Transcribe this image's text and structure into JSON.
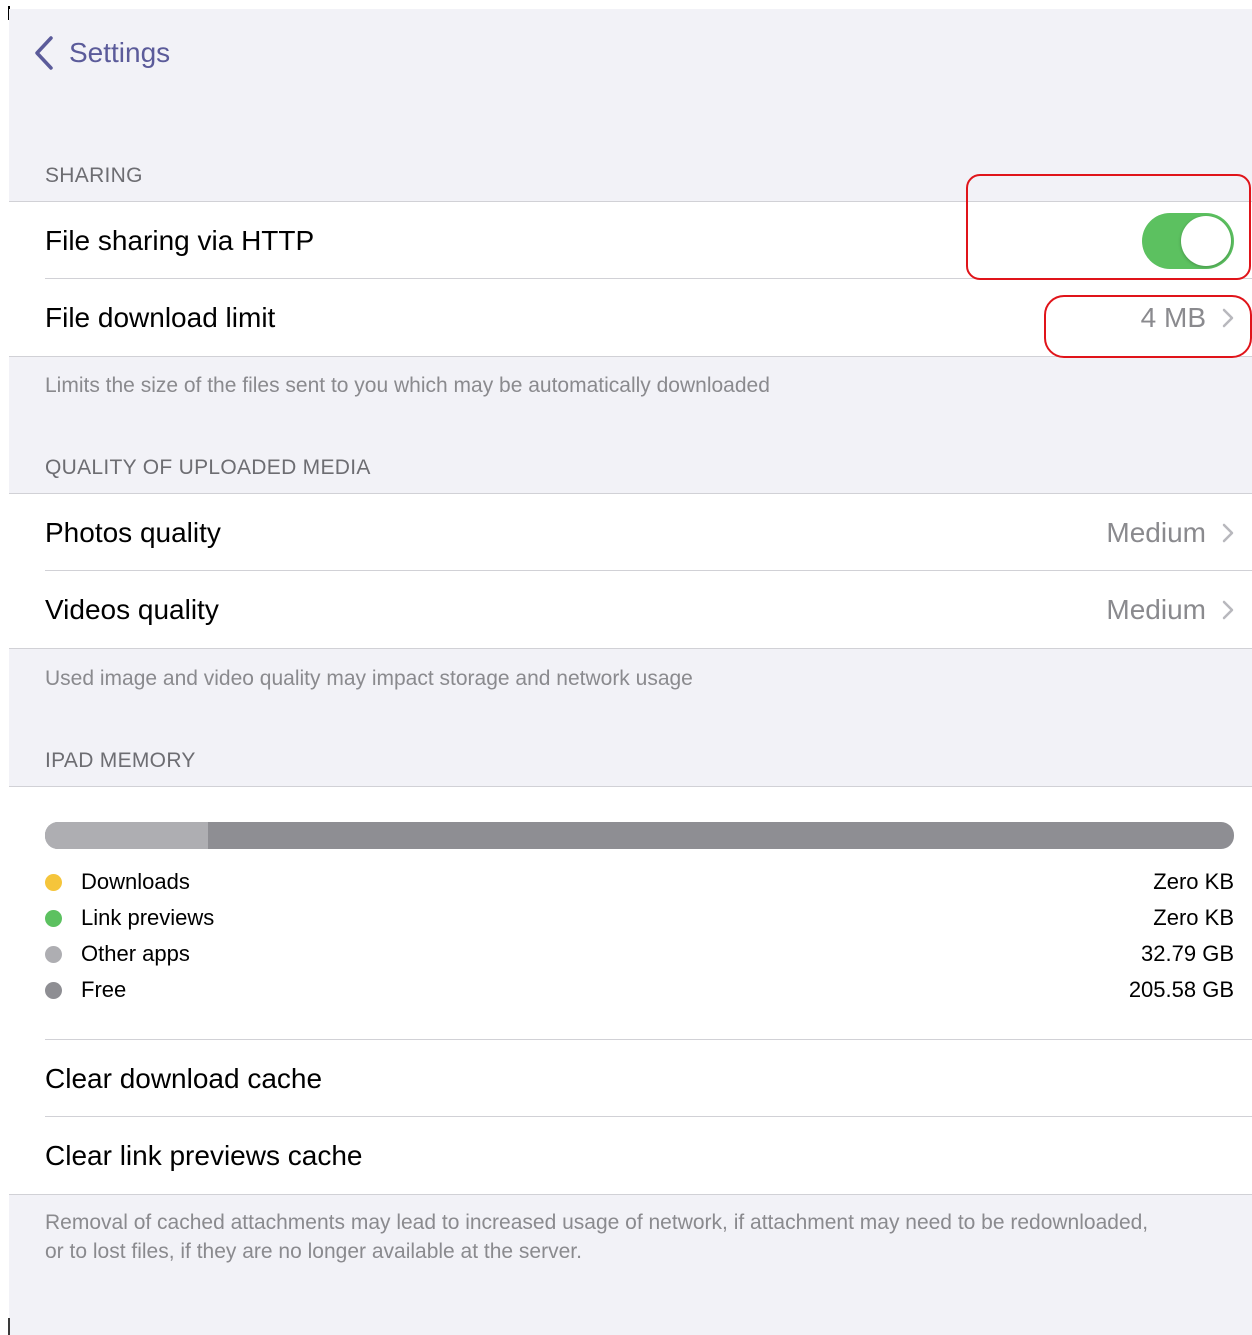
{
  "nav": {
    "back_label": "Settings"
  },
  "sharing": {
    "header": "SHARING",
    "http_label": "File sharing via HTTP",
    "http_enabled": true,
    "limit_label": "File download limit",
    "limit_value": "4 MB",
    "footer": "Limits the size of the files sent to you which may be automatically downloaded"
  },
  "media": {
    "header": "QUALITY OF UPLOADED MEDIA",
    "photos_label": "Photos quality",
    "photos_value": "Medium",
    "videos_label": "Videos quality",
    "videos_value": "Medium",
    "footer": "Used image and video quality may impact storage and network usage"
  },
  "memory": {
    "header": "IPAD MEMORY",
    "usage": {
      "downloads_fraction": 0.0,
      "link_previews_fraction": 0.0,
      "other_apps_fraction": 0.1375,
      "free_fraction": 0.8625
    },
    "legend": [
      {
        "label": "Downloads",
        "value": "Zero KB",
        "color": "#f5c53b"
      },
      {
        "label": "Link previews",
        "value": "Zero KB",
        "color": "#5cc160"
      },
      {
        "label": "Other apps",
        "value": "32.79 GB",
        "color": "#aeaeb2"
      },
      {
        "label": "Free",
        "value": "205.58 GB",
        "color": "#8e8e93"
      }
    ],
    "clear_download_label": "Clear download cache",
    "clear_previews_label": "Clear link previews cache",
    "footer": "Removal of cached attachments may lead to increased usage of network, if attachment may need to be redownloaded, or to lost files, if they are no longer available at the server."
  },
  "colors": {
    "accent": "#5b5b9a",
    "toggle_on": "#5cc160",
    "annotation": "#e0141a"
  },
  "icons": {
    "back": "chevron-left-icon",
    "disclosure": "chevron-right-icon"
  }
}
